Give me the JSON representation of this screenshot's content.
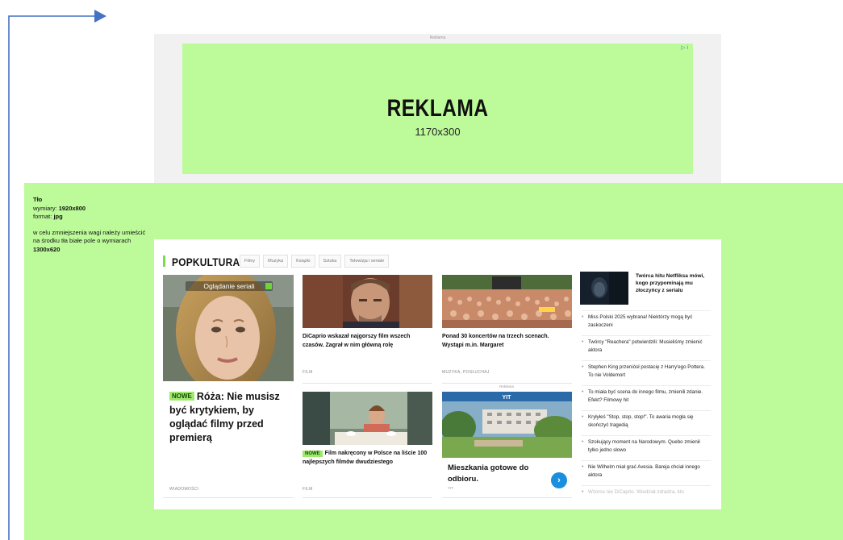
{
  "ad": {
    "top_label": "Reklama",
    "title": "REKLAMA",
    "size": "1170x300",
    "adchoice_label": "▷ i"
  },
  "notes": {
    "heading": "Tło",
    "dimensions_label": "wymiary:",
    "dimensions_value": "1920x800",
    "format_label": "format:",
    "format_value": "jpg",
    "instruction": "w celu zmniejszenia wagi należy umieścić na środku tła białe pole o wymiarach",
    "instruction_size": "1300x620"
  },
  "section": {
    "title": "POPKULTURA",
    "tabs": [
      "Filmy",
      "Muzyka",
      "Książki",
      "Sztuka",
      "Telewizja i seriale"
    ]
  },
  "big_card": {
    "overlay_label": "Oglądanie seriali",
    "badge": "NOWE",
    "title": "Róża: Nie musisz być krytykiem, by oglądać filmy przed premierą",
    "category": "WIADOMOŚCI"
  },
  "cards": [
    {
      "title": "DiCaprio wskazał najgorszy film wszech czasów. Zagrał w nim główną rolę",
      "category": "FILM"
    },
    {
      "title": "Ponad 30 koncertów na trzech scenach. Wystąpi m.in. Margaret",
      "category": "MUZYKA, POSŁUCHAJ"
    },
    {
      "badge": "NOWE",
      "title": "Film nakręcony w Polsce na liście 100 najlepszych filmów dwudziestego",
      "category": "FILM"
    }
  ],
  "ad_card": {
    "label": "Reklama",
    "brand": "YIT",
    "text_line1": "Mieszkania gotowe do",
    "text_line2": "odbioru.",
    "source": "YIT",
    "button": "›"
  },
  "right_column": {
    "headline": "Twórca hitu Netfliksa mówi, kogo przypominają mu złoczyńcy z serialu",
    "items": [
      "Miss Polski 2025 wybrana! Niektórzy mogą być zaskoczeni",
      "Twórcy \"Reachera\" potwierdzili: Musieliśmy zmienić aktora",
      "Stephen King przeniósł postacię z Harry'ego Pottera. To nie Voldemort",
      "To miała być scena do innego filmu, zmienili zdanie. Efekt? Filmowy hit",
      "Kryłyłeś \"Stop, stop, stop!\". To awaria mogła się skończyć tragedią",
      "Szokujący moment na Narodowym. Quebo zmienił tylko jedno słowo",
      "Nie Wilhelm miał grać Avesia. Bareja chciał innego aktora",
      "Wzorce nie DiCaprio. Wiedział zdradza, kto"
    ]
  },
  "colors": {
    "background_green": "#bdfb9a",
    "accent_green": "#7bd84f",
    "badge_green": "#9fe86c",
    "arrow_blue": "#4472c4",
    "ad_button_blue": "#1a8fe0"
  }
}
